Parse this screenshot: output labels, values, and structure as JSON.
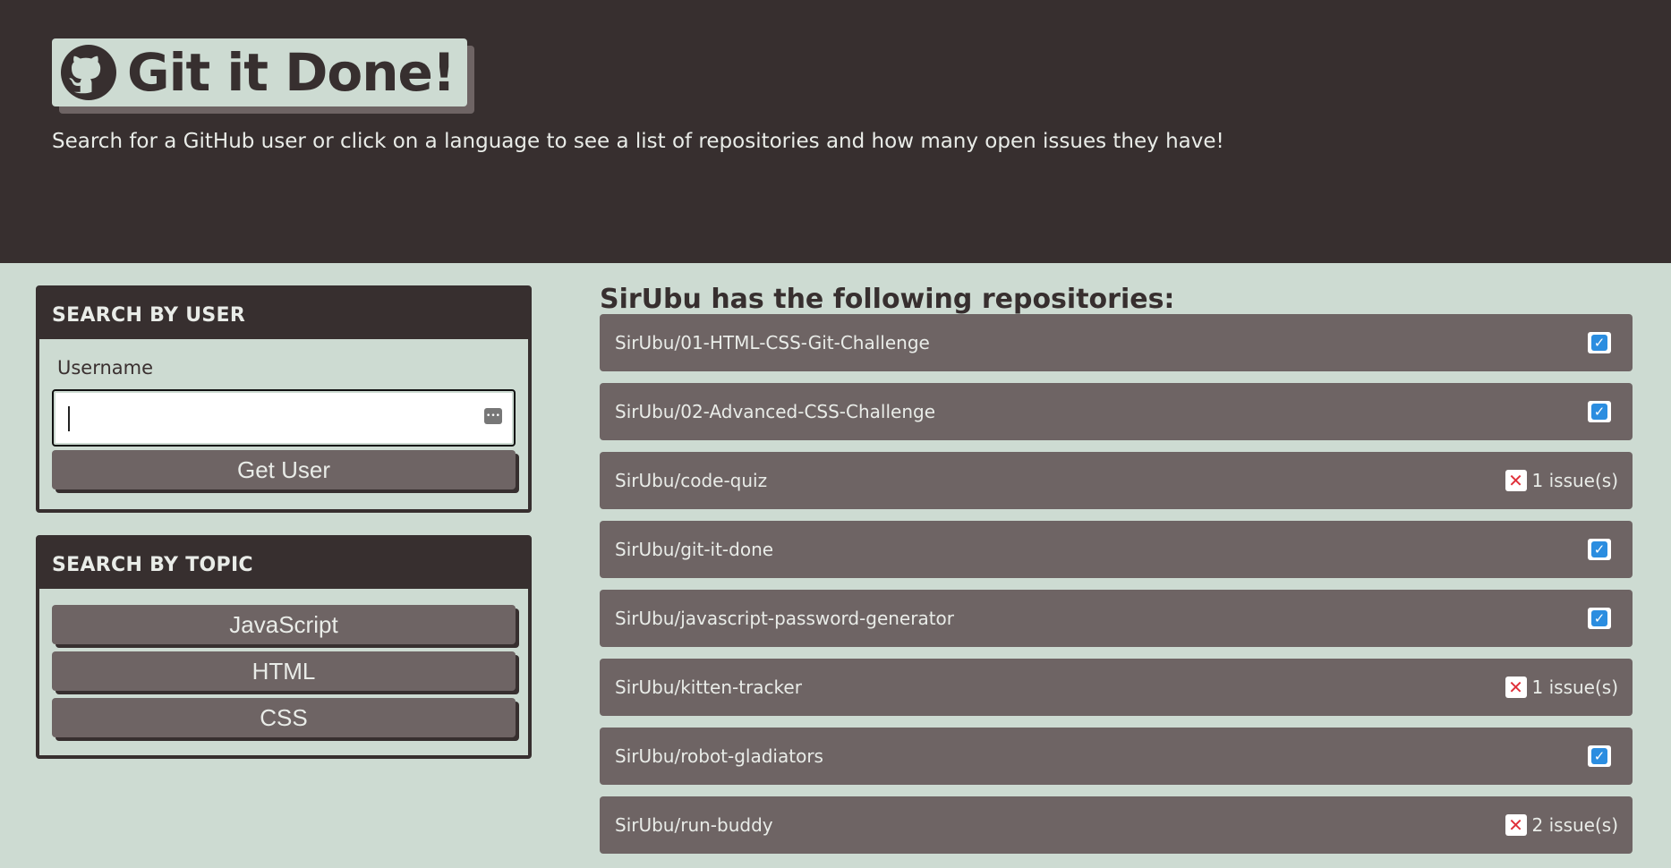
{
  "header": {
    "title": "Git it Done!",
    "subtitle": "Search for a GitHub user or click on a language to see a list of repositories and how many open issues they have!"
  },
  "user_search": {
    "heading": "SEARCH BY USER",
    "label": "Username",
    "input_value": "",
    "button_label": "Get User"
  },
  "topic_search": {
    "heading": "SEARCH BY TOPIC",
    "topics": [
      "JavaScript",
      "HTML",
      "CSS"
    ]
  },
  "results": {
    "heading": "SirUbu has the following repositories:",
    "repos": [
      {
        "name": "SirUbu/01-HTML-CSS-Git-Challenge",
        "status": "check",
        "issues": ""
      },
      {
        "name": "SirUbu/02-Advanced-CSS-Challenge",
        "status": "check",
        "issues": ""
      },
      {
        "name": "SirUbu/code-quiz",
        "status": "x",
        "issues": "1 issue(s)"
      },
      {
        "name": "SirUbu/git-it-done",
        "status": "check",
        "issues": ""
      },
      {
        "name": "SirUbu/javascript-password-generator",
        "status": "check",
        "issues": ""
      },
      {
        "name": "SirUbu/kitten-tracker",
        "status": "x",
        "issues": "1 issue(s)"
      },
      {
        "name": "SirUbu/robot-gladiators",
        "status": "check",
        "issues": ""
      },
      {
        "name": "SirUbu/run-buddy",
        "status": "x",
        "issues": "2 issue(s)"
      }
    ]
  },
  "icons": {
    "logo": "github-icon",
    "password": "password-manager-icon",
    "check": "check-square-icon",
    "x": "x-square-icon"
  },
  "colors": {
    "header_bg": "#372f2f",
    "page_bg": "#cddbd2",
    "item_bg": "#6e6464",
    "check_blue": "#2b8de0",
    "x_red": "#e0303a"
  }
}
